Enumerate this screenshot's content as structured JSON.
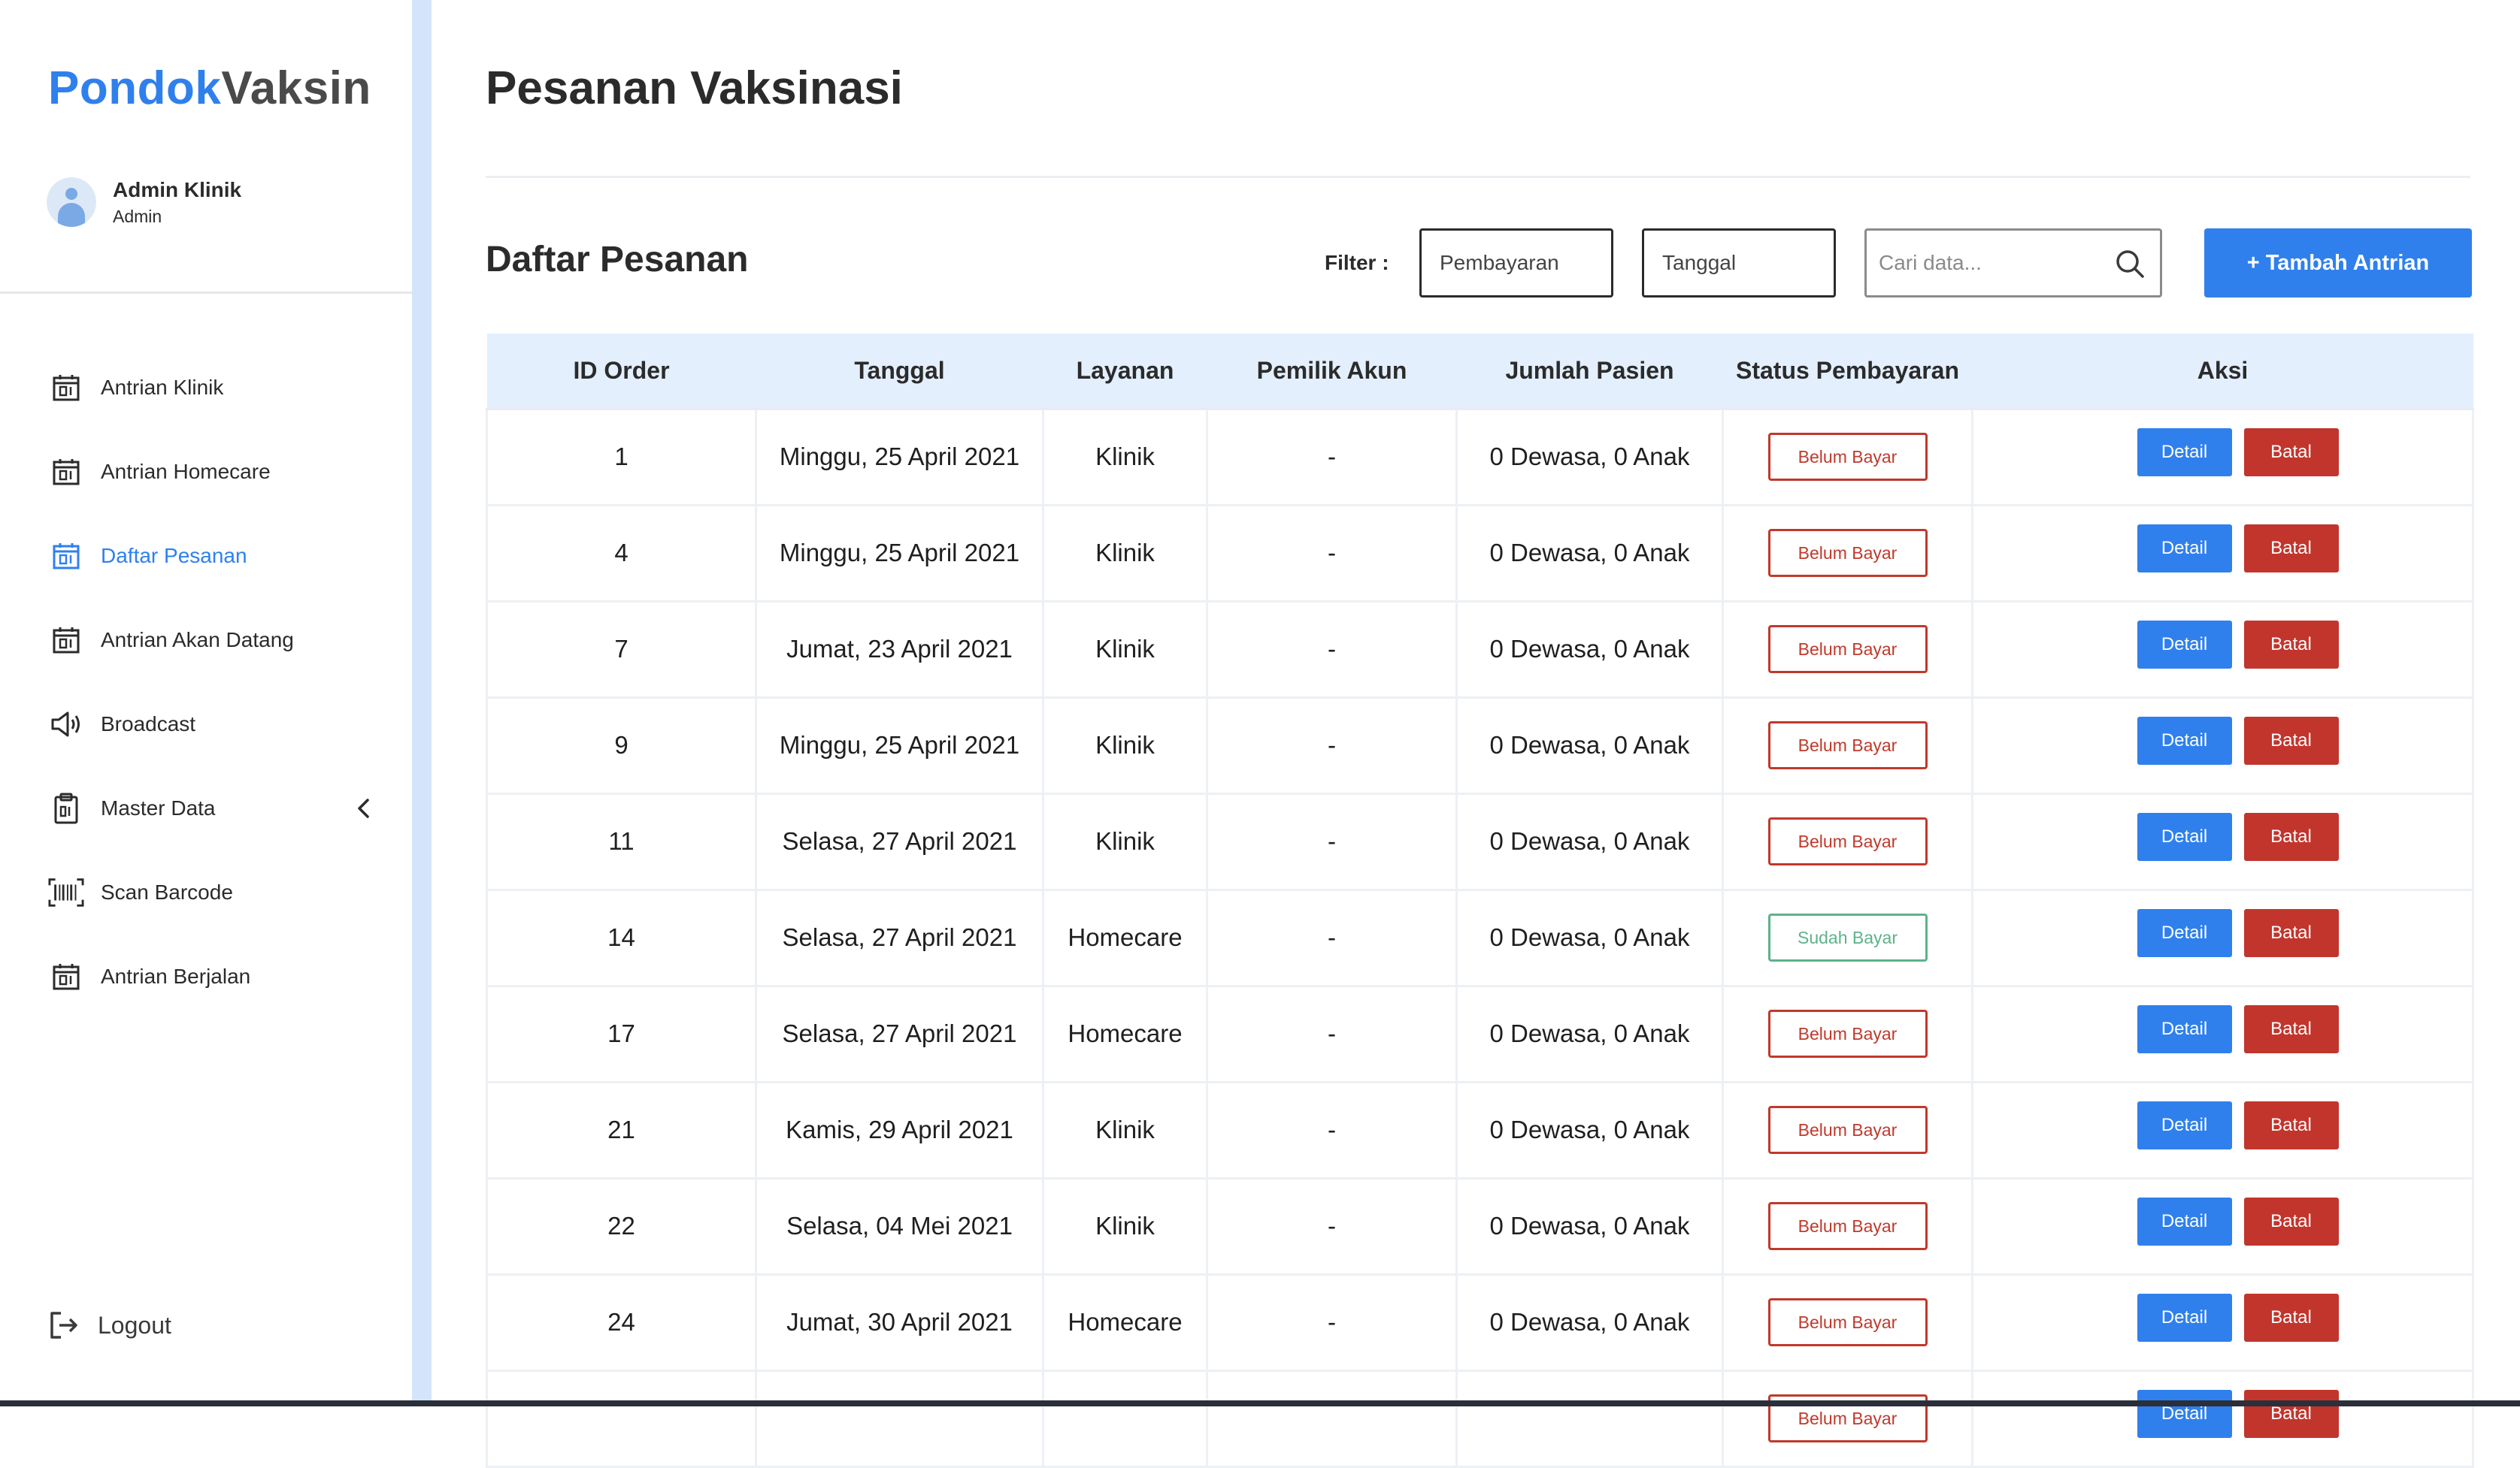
{
  "app": {
    "logo_part1": "Pondok",
    "logo_part2": "Vaksin"
  },
  "user": {
    "name": "Admin Klinik",
    "role": "Admin"
  },
  "sidebar": {
    "items": [
      {
        "label": "Antrian Klinik",
        "icon": "calendar-icon",
        "active": false
      },
      {
        "label": "Antrian Homecare",
        "icon": "calendar-icon",
        "active": false
      },
      {
        "label": "Daftar Pesanan",
        "icon": "calendar-icon",
        "active": true
      },
      {
        "label": "Antrian Akan Datang",
        "icon": "calendar-icon",
        "active": false
      },
      {
        "label": "Broadcast",
        "icon": "megaphone-icon",
        "active": false
      },
      {
        "label": "Master Data",
        "icon": "clipboard-icon",
        "active": false
      },
      {
        "label": "Scan Barcode",
        "icon": "barcode-icon",
        "active": false
      },
      {
        "label": "Antrian Berjalan",
        "icon": "calendar-icon",
        "active": false
      }
    ],
    "logout_label": "Logout"
  },
  "page": {
    "title": "Pesanan Vaksinasi",
    "section_title": "Daftar Pesanan"
  },
  "filter": {
    "label": "Filter :",
    "payment_select": "Pembayaran",
    "date_select": "Tanggal",
    "search_placeholder": "Cari data...",
    "add_button": "+ Tambah Antrian"
  },
  "table": {
    "headers": [
      "ID Order",
      "Tanggal",
      "Layanan",
      "Pemilik Akun",
      "Jumlah Pasien",
      "Status Pembayaran",
      "Aksi"
    ],
    "detail_label": "Detail",
    "cancel_label": "Batal",
    "rows": [
      {
        "id": "1",
        "date": "Minggu, 25 April 2021",
        "service": "Klinik",
        "owner": "-",
        "patients": "0 Dewasa, 0 Anak",
        "status": "Belum Bayar"
      },
      {
        "id": "4",
        "date": "Minggu, 25 April 2021",
        "service": "Klinik",
        "owner": "-",
        "patients": "0 Dewasa, 0 Anak",
        "status": "Belum Bayar"
      },
      {
        "id": "7",
        "date": "Jumat, 23 April 2021",
        "service": "Klinik",
        "owner": "-",
        "patients": "0 Dewasa, 0 Anak",
        "status": "Belum Bayar"
      },
      {
        "id": "9",
        "date": "Minggu, 25 April 2021",
        "service": "Klinik",
        "owner": "-",
        "patients": "0 Dewasa, 0 Anak",
        "status": "Belum Bayar"
      },
      {
        "id": "11",
        "date": "Selasa, 27 April 2021",
        "service": "Klinik",
        "owner": "-",
        "patients": "0 Dewasa, 0 Anak",
        "status": "Belum Bayar"
      },
      {
        "id": "14",
        "date": "Selasa, 27 April 2021",
        "service": "Homecare",
        "owner": "-",
        "patients": "0 Dewasa, 0 Anak",
        "status": "Sudah Bayar"
      },
      {
        "id": "17",
        "date": "Selasa, 27 April 2021",
        "service": "Homecare",
        "owner": "-",
        "patients": "0 Dewasa, 0 Anak",
        "status": "Belum Bayar"
      },
      {
        "id": "21",
        "date": "Kamis, 29 April 2021",
        "service": "Klinik",
        "owner": "-",
        "patients": "0 Dewasa, 0 Anak",
        "status": "Belum Bayar"
      },
      {
        "id": "22",
        "date": "Selasa, 04 Mei 2021",
        "service": "Klinik",
        "owner": "-",
        "patients": "0 Dewasa, 0 Anak",
        "status": "Belum Bayar"
      },
      {
        "id": "24",
        "date": "Jumat, 30 April 2021",
        "service": "Homecare",
        "owner": "-",
        "patients": "0 Dewasa, 0 Anak",
        "status": "Belum Bayar"
      },
      {
        "id": "",
        "date": "",
        "service": "",
        "owner": "",
        "patients": "",
        "status": "Belum Bayar"
      }
    ]
  },
  "colors": {
    "accent": "#2f80ed",
    "danger": "#c2352d",
    "success": "#5cb38a",
    "header_bg": "#e3effd",
    "stripe": "#d4e5fb"
  }
}
